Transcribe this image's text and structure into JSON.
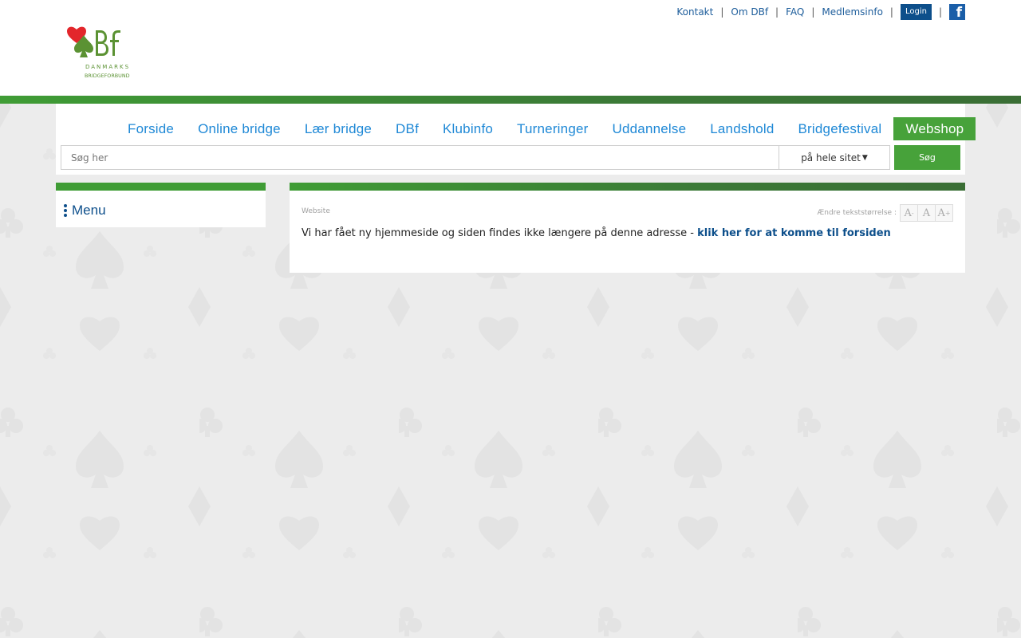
{
  "header": {
    "links": [
      {
        "label": "Kontakt"
      },
      {
        "label": "Om DBf"
      },
      {
        "label": "FAQ"
      },
      {
        "label": "Medlemsinfo"
      }
    ],
    "login_label": "Login",
    "separator": "|",
    "logo": {
      "monogram": "DBf",
      "line1": "DANMARKS",
      "line2": "BRIDGEFORBUND"
    }
  },
  "nav": {
    "items": [
      {
        "label": "Forside"
      },
      {
        "label": "Online bridge"
      },
      {
        "label": "Lær bridge"
      },
      {
        "label": "DBf"
      },
      {
        "label": "Klubinfo"
      },
      {
        "label": "Turneringer"
      },
      {
        "label": "Uddannelse"
      },
      {
        "label": "Landshold"
      },
      {
        "label": "Bridgefestival"
      },
      {
        "label": "Webshop"
      }
    ]
  },
  "search": {
    "placeholder": "Søg her",
    "value": "",
    "scope": "på hele sitet",
    "button_label": "Søg"
  },
  "sidebar": {
    "menu_label": "Menu"
  },
  "content": {
    "breadcrumb": "Website",
    "font_size_label": "Ændre tekststørrelse :",
    "font_buttons": {
      "smaller": "A-",
      "normal": "A",
      "larger": "A+"
    },
    "message_text": "Vi har fået ny hjemmeside og siden findes ikke længere på denne adresse - ",
    "message_link": "klik her for at komme til forsiden"
  },
  "colors": {
    "brand_green": "#47a23a",
    "brand_blue": "#0d4f8b",
    "nav_blue": "#1e88d6",
    "logo_red": "#e3262b",
    "logo_green": "#5b9233"
  },
  "icons": [
    "facebook-icon",
    "menu-dots-icon",
    "caret-down-icon"
  ]
}
